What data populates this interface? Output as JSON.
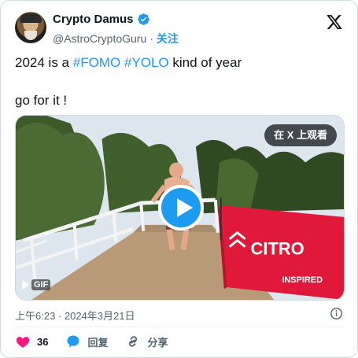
{
  "author": {
    "display_name": "Crypto Damus",
    "handle": "@AstroCryptoGuru",
    "separator": "·",
    "follow_label": "关注",
    "verified": true
  },
  "tweet": {
    "line1_prefix": "2024 is a ",
    "hashtag1": "#FOMO",
    "hashtag2": "#YOLO",
    "line1_suffix": " kind of year",
    "line2": "go for it !"
  },
  "media": {
    "watch_on_x_label": "在 X 上观看",
    "gif_label": "GIF",
    "banner_text": "CITRO",
    "banner_subtext": "INSPIRED"
  },
  "timestamp": "上午6:23 · 2024年3月21日",
  "actions": {
    "like_count": "36",
    "reply_label": "回复",
    "share_label": "分享"
  },
  "colors": {
    "accent": "#1d9bf0",
    "like": "#f91880",
    "muted": "#536471",
    "banner_red": "#e0183a"
  }
}
